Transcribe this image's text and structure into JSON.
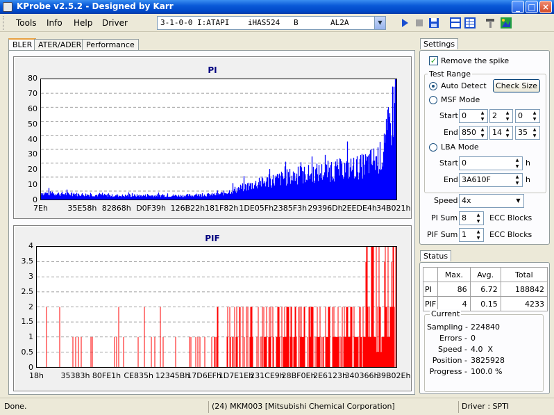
{
  "window": {
    "title": "KProbe v2.5.2 - Designed by Karr"
  },
  "menu": [
    "Tools",
    "Info",
    "Help",
    "Driver"
  ],
  "drive_select": {
    "value": "3-1-0-0 I:ATAPI    iHAS524   B       AL2A"
  },
  "toolbar": [
    "play-icon",
    "stop-icon",
    "save-icon",
    "window-layout-icon",
    "grid-icon",
    "tools-icon",
    "picture-icon"
  ],
  "tabs": [
    "BLER",
    "ATER/ADER",
    "Performance"
  ],
  "pi_chart": {
    "title": "PI",
    "y_ticks": [
      "80",
      "70",
      "60",
      "50",
      "40",
      "30",
      "20",
      "10",
      "0"
    ],
    "x_ticks": [
      "7Eh",
      "35E58h",
      "82868h",
      "D0F39h",
      "126B22h",
      "181F82h",
      "1DE05Fh",
      "2385F3h",
      "29396Dh",
      "2EEDE4h",
      "34B021h"
    ],
    "color": "#0000ff"
  },
  "pif_chart": {
    "title": "PIF",
    "y_ticks": [
      "4",
      "3.5",
      "3",
      "2.5",
      "2",
      "1.5",
      "1",
      "0.5",
      "0"
    ],
    "x_ticks": [
      "18h",
      "35383h",
      "80FE1h",
      "CE835h",
      "12345Bh",
      "17D6EFh",
      "1D7E1Eh",
      "231CE9h",
      "28BF0Eh",
      "2E6123h",
      "340366h",
      "39B02Eh"
    ],
    "color": "#ff0000"
  },
  "chart_data": [
    {
      "type": "bar",
      "title": "PI",
      "ylim": [
        0,
        86
      ],
      "x": [
        "7Eh",
        "35E58h",
        "82868h",
        "D0F39h",
        "126B22h",
        "181F82h",
        "1DE05Fh",
        "2385F3h",
        "29396Dh",
        "2EEDE4h",
        "34B021h"
      ],
      "values": [
        5,
        4,
        3,
        3,
        3,
        4,
        12,
        18,
        22,
        26,
        40
      ],
      "peak": 86
    },
    {
      "type": "bar",
      "title": "PIF",
      "ylim": [
        0,
        4
      ],
      "x": [
        "18h",
        "35383h",
        "80FE1h",
        "CE835h",
        "12345Bh",
        "17D6EFh",
        "1D7E1Eh",
        "231CE9h",
        "28BF0Eh",
        "2E6123h",
        "340366h",
        "39B02Eh"
      ],
      "values": [
        0,
        2,
        1,
        1,
        2,
        2,
        2,
        2,
        2,
        2,
        2,
        4
      ]
    }
  ],
  "settings": {
    "tab": "Settings",
    "remove_spike": "Remove the spike",
    "test_range": "Test Range",
    "auto_detect": "Auto Detect",
    "check_size": "Check Size",
    "msf_mode": "MSF Mode",
    "start_label": "Start",
    "end_label": "End",
    "msf_start": [
      "0",
      "2",
      "0"
    ],
    "msf_end": [
      "850",
      "14",
      "35"
    ],
    "lba_mode": "LBA Mode",
    "lba_start": "0",
    "lba_end": "3A610F",
    "h": "h",
    "speed_label": "Speed",
    "speed_value": "4x",
    "pi_sum_label": "PI Sum",
    "pi_sum_value": "8",
    "pif_sum_label": "PIF Sum",
    "pif_sum_value": "1",
    "ecc_blocks": "ECC Blocks"
  },
  "status": {
    "tab": "Status",
    "headers": [
      "",
      "Max.",
      "Avg.",
      "Total"
    ],
    "rows": [
      [
        "PI",
        "86",
        "6.72",
        "188842"
      ],
      [
        "PIF",
        "4",
        "0.15",
        "4233"
      ]
    ],
    "current": "Current",
    "sampling_label": "Sampling -",
    "sampling": "224840",
    "errors_label": "Errors -",
    "errors": "0",
    "speed_label": "Speed -",
    "speed": "4.0  X",
    "position_label": "Position -",
    "position": "3825928",
    "progress_label": "Progress -",
    "progress": "100.0 %"
  },
  "statusbar": {
    "left": "Done.",
    "middle": "(24) MKM003 [Mitsubishi Chemical Corporation]",
    "right": "Driver : SPTI"
  }
}
